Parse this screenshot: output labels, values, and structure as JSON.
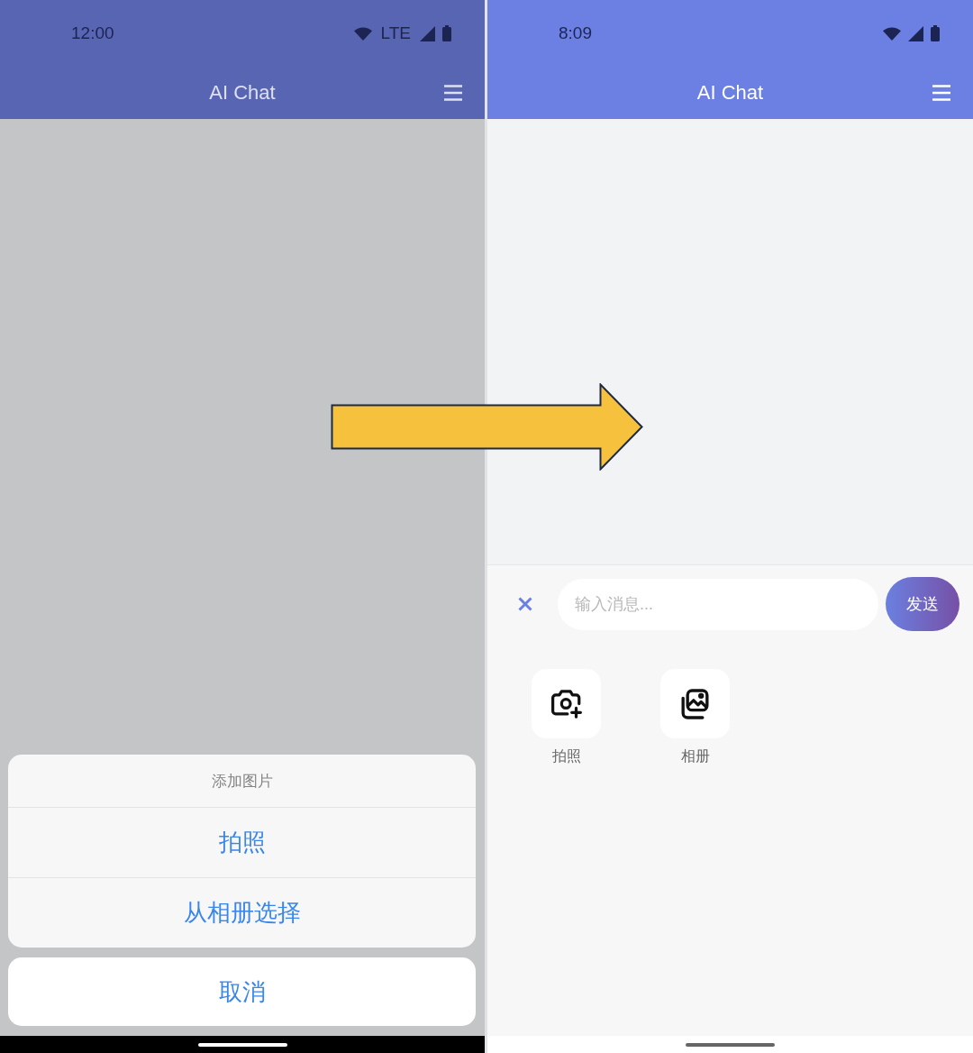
{
  "screens": [
    {
      "status_bar": {
        "time": "12:00",
        "network": "LTE"
      },
      "app_bar": {
        "title": "AI Chat"
      },
      "scrim": true,
      "action_sheet": {
        "title": "添加图片",
        "options": [
          "拍照",
          "从相册选择"
        ],
        "cancel": "取消"
      }
    },
    {
      "status_bar": {
        "time": "8:09"
      },
      "app_bar": {
        "title": "AI Chat"
      },
      "scrim": false,
      "composer": {
        "placeholder": "输入消息...",
        "send": "发送"
      },
      "attachments": [
        {
          "kind": "camera",
          "label": "拍照"
        },
        {
          "kind": "gallery",
          "label": "相册"
        }
      ]
    }
  ]
}
